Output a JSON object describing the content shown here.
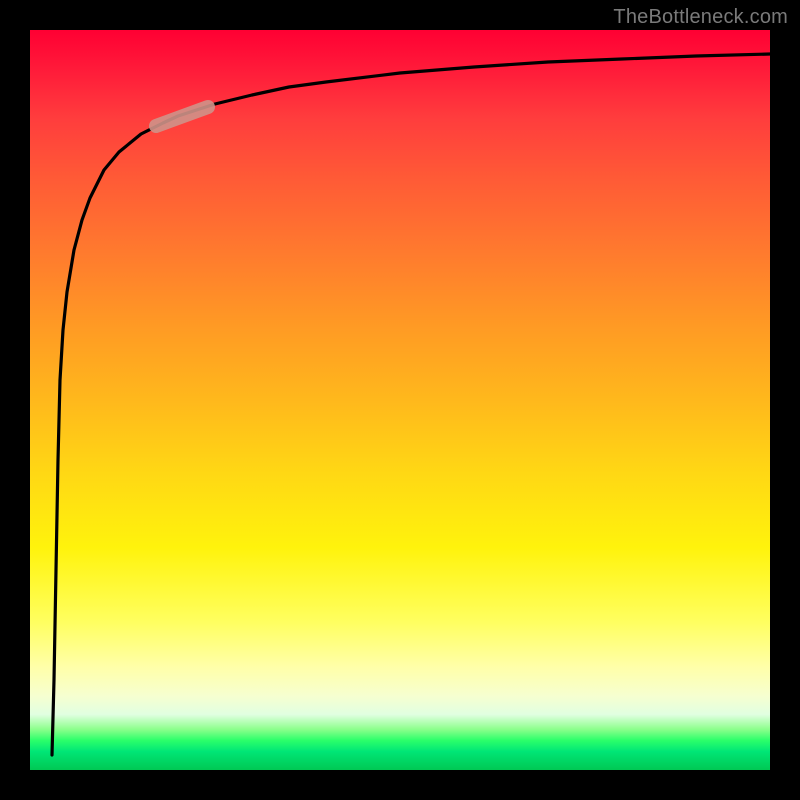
{
  "attribution": "TheBottleneck.com",
  "colors": {
    "page_bg": "#000000",
    "gradient_top": "#ff0033",
    "gradient_mid1": "#ff7a2e",
    "gradient_mid2": "#fff30c",
    "gradient_bottom": "#00c853",
    "curve": "#000000",
    "highlight": "#c98a80"
  },
  "chart_data": {
    "type": "line",
    "title": "",
    "xlabel": "",
    "ylabel": "",
    "xlim": [
      0,
      100
    ],
    "ylim": [
      0,
      100
    ],
    "grid": false,
    "legend": false,
    "description": "Single black curve on a red-to-green vertical gradient. The curve starts at the bottom-left near y≈0, shoots almost vertically to the top, then asymptotically levels off toward y≈100 across the width. A short pale-rose highlight segment sits on the curve around x≈20, y≈88.",
    "series": [
      {
        "name": "curve",
        "x": [
          3.0,
          3.2,
          3.5,
          3.8,
          4.0,
          4.5,
          5.0,
          6.0,
          7.0,
          8.0,
          10.0,
          12.0,
          15.0,
          18.0,
          20.0,
          25.0,
          30.0,
          35.0,
          40.0,
          50.0,
          60.0,
          70.0,
          80.0,
          90.0,
          100.0
        ],
        "y": [
          2.0,
          10.0,
          25.0,
          40.0,
          50.0,
          58.0,
          63.0,
          70.0,
          74.0,
          77.0,
          81.0,
          83.5,
          86.0,
          87.5,
          88.3,
          90.0,
          91.3,
          92.3,
          93.0,
          94.2,
          95.0,
          95.6,
          96.1,
          96.5,
          96.8
        ]
      }
    ],
    "highlight_segment": {
      "x_start": 17.0,
      "x_end": 24.0,
      "y_start": 87.0,
      "y_end": 89.5
    }
  }
}
